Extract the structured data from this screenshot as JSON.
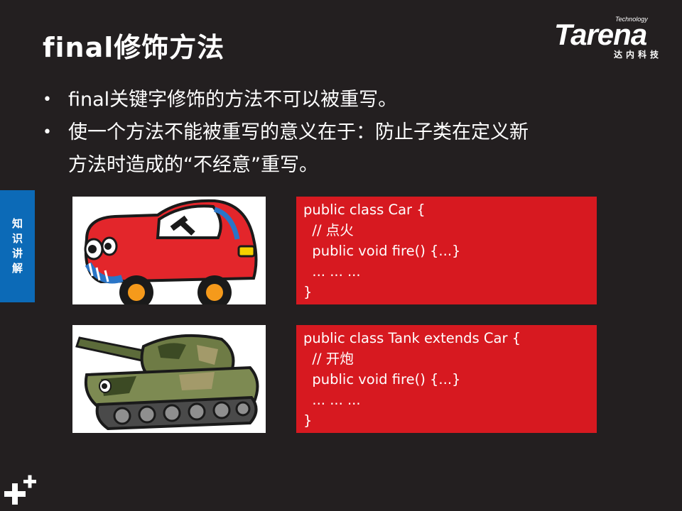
{
  "slide": {
    "title": "final修饰方法",
    "bullets": [
      {
        "text": "final关键字修饰的方法不可以被重写。"
      },
      {
        "line1": "使一个方法不能被重写的意义在于：防止子类在定义新",
        "line2": "方法时造成的“不经意”重写。"
      }
    ]
  },
  "logo": {
    "word": "Tarena",
    "tagline": "Technology",
    "cn": "达内科技"
  },
  "side_tab": {
    "chars": [
      "知",
      "识",
      "讲",
      "解"
    ],
    "color": "#0c6ab7"
  },
  "images": {
    "car": {
      "icon": "cartoon-car-icon"
    },
    "tank": {
      "icon": "cartoon-tank-icon"
    }
  },
  "code_blocks": {
    "car": {
      "lines": [
        "public class Car {",
        "  // 点火",
        "  public void fire() {...}",
        "  ... ... ...",
        "}"
      ]
    },
    "tank": {
      "lines": [
        "public class Tank extends Car {",
        "  // 开炮",
        "  public void fire() {...}",
        "  ... ... ...",
        "}"
      ]
    }
  },
  "colors": {
    "background": "#231f20",
    "code_bg": "#d71920",
    "accent_blue": "#0c6ab7"
  }
}
